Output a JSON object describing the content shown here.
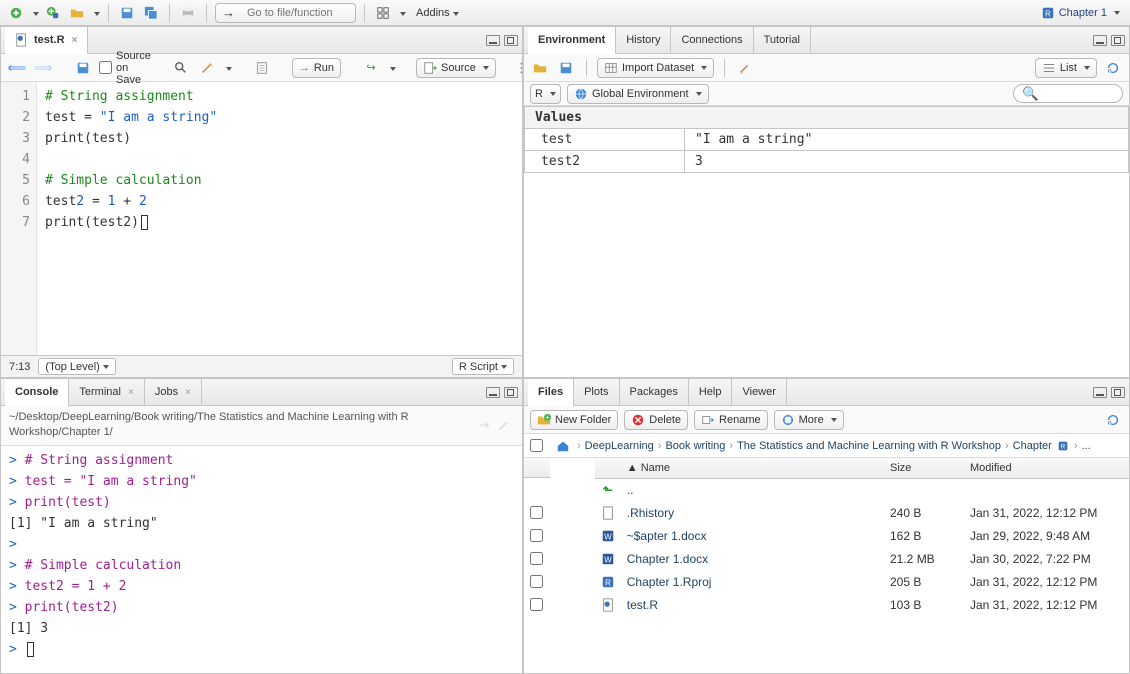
{
  "top": {
    "goto_placeholder": "Go to file/function",
    "addins": "Addins",
    "project": "Chapter 1"
  },
  "source": {
    "tab": "test.R",
    "source_on_save": "Source on Save",
    "run": "Run",
    "source_btn": "Source",
    "status_pos": "7:13",
    "status_scope": "(Top Level)",
    "status_type": "R Script",
    "lines": [
      {
        "n": 1,
        "raw": "# String assignment",
        "cls": "cmt"
      },
      {
        "n": 2,
        "raw": "test = \"I am a string\"",
        "cls": "assign_str"
      },
      {
        "n": 3,
        "raw": "print(test)",
        "cls": "plain"
      },
      {
        "n": 4,
        "raw": "",
        "cls": "plain"
      },
      {
        "n": 5,
        "raw": "# Simple calculation",
        "cls": "cmt"
      },
      {
        "n": 6,
        "raw": "test2 = 1 + 2",
        "cls": "assign_num"
      },
      {
        "n": 7,
        "raw": "print(test2)",
        "cls": "plain_caret"
      }
    ]
  },
  "env": {
    "tabs": [
      "Environment",
      "History",
      "Connections",
      "Tutorial"
    ],
    "import": "Import Dataset",
    "list": "List",
    "r_menu": "R",
    "scope": "Global Environment",
    "values_hdr": "Values",
    "rows": [
      {
        "name": "test",
        "val": "\"I am a string\""
      },
      {
        "name": "test2",
        "val": "3"
      }
    ]
  },
  "console": {
    "tabs": [
      "Console",
      "Terminal",
      "Jobs"
    ],
    "path": "~/Desktop/DeepLearning/Book writing/The Statistics and Machine Learning with R Workshop/Chapter 1/",
    "lines": [
      {
        "t": "cmd",
        "txt": "# String assignment"
      },
      {
        "t": "cmd",
        "txt": "test = \"I am a string\""
      },
      {
        "t": "cmd",
        "txt": "print(test)"
      },
      {
        "t": "out",
        "txt": "[1] \"I am a string\""
      },
      {
        "t": "cmd",
        "txt": ""
      },
      {
        "t": "cmd",
        "txt": "# Simple calculation"
      },
      {
        "t": "cmd",
        "txt": "test2 = 1 + 2"
      },
      {
        "t": "cmd",
        "txt": "print(test2)"
      },
      {
        "t": "out",
        "txt": "[1] 3"
      },
      {
        "t": "prompt",
        "txt": ""
      }
    ]
  },
  "files": {
    "tabs": [
      "Files",
      "Plots",
      "Packages",
      "Help",
      "Viewer"
    ],
    "new_folder": "New Folder",
    "delete": "Delete",
    "rename": "Rename",
    "more": "More",
    "breadcrumbs": [
      "DeepLearning",
      "Book writing",
      "The Statistics and Machine Learning with R Workshop",
      "Chapter"
    ],
    "ellipsis": "...",
    "cols": {
      "name": "Name",
      "size": "Size",
      "modified": "Modified"
    },
    "up": "..",
    "rows": [
      {
        "icon": "file",
        "name": ".Rhistory",
        "size": "240 B",
        "modified": "Jan 31, 2022, 12:12 PM"
      },
      {
        "icon": "word",
        "name": "~$apter 1.docx",
        "size": "162 B",
        "modified": "Jan 29, 2022, 9:48 AM"
      },
      {
        "icon": "word",
        "name": "Chapter 1.docx",
        "size": "21.2 MB",
        "modified": "Jan 30, 2022, 7:22 PM"
      },
      {
        "icon": "rproj",
        "name": "Chapter 1.Rproj",
        "size": "205 B",
        "modified": "Jan 31, 2022, 12:12 PM"
      },
      {
        "icon": "rfile",
        "name": "test.R",
        "size": "103 B",
        "modified": "Jan 31, 2022, 12:12 PM"
      }
    ]
  }
}
